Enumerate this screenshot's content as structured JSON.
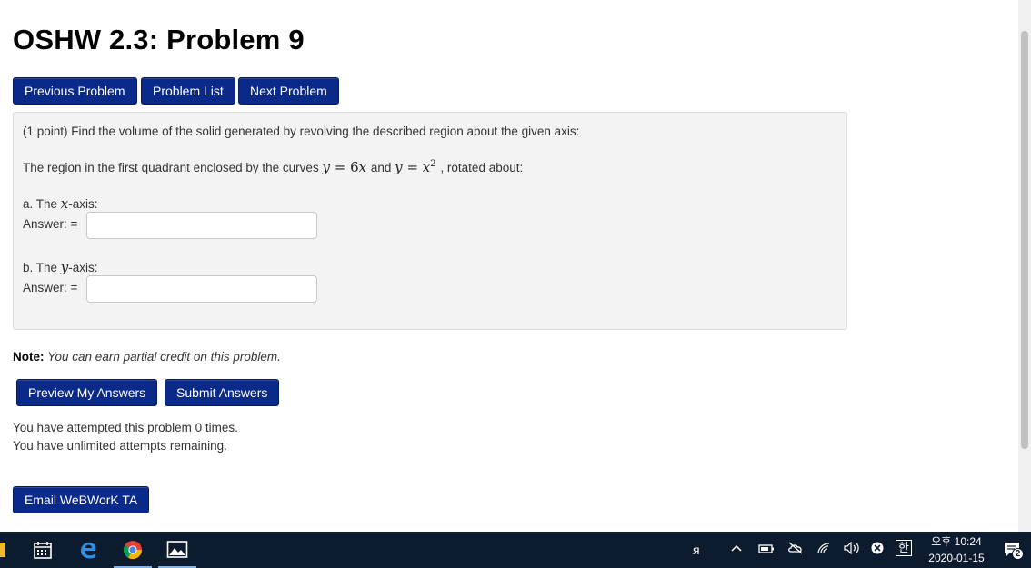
{
  "page": {
    "title": "OSHW 2.3: Problem 9"
  },
  "nav": {
    "previous": "Previous Problem",
    "list": "Problem List",
    "next": "Next Problem"
  },
  "problem": {
    "intro": "(1 point) Find the volume of the solid generated by revolving the described region about the given axis:",
    "region_prefix": "The region in the first quadrant enclosed by the curves",
    "curve1_lhs": "y",
    "curve1_eq": "=",
    "curve1_coef": "6",
    "curve1_var": "x",
    "and_word": "and",
    "curve2_lhs": "y",
    "curve2_eq": "=",
    "curve2_var": "x",
    "curve2_exp": "2",
    "region_suffix": ", rotated about:",
    "part_a_prefix": "a. The",
    "part_a_var": "x",
    "part_a_suffix": "-axis:",
    "part_b_prefix": "b. The",
    "part_b_var": "y",
    "part_b_suffix": "-axis:",
    "answer_label": "Answer: =",
    "answer_a_value": "",
    "answer_b_value": ""
  },
  "note": {
    "label": "Note:",
    "text": "You can earn partial credit on this problem."
  },
  "actions": {
    "preview": "Preview My Answers",
    "submit": "Submit Answers",
    "email": "Email WeBWorK TA"
  },
  "status": {
    "attempted": "You have attempted this problem 0 times.",
    "remaining": "You have unlimited attempts remaining."
  },
  "taskbar": {
    "icons": [
      "calendar-icon",
      "edge-icon",
      "chrome-icon",
      "photos-icon"
    ],
    "tray_people": "ᴙ",
    "ime": "한",
    "time": "오후 10:24",
    "date": "2020-01-15",
    "notifications": "2"
  },
  "colors": {
    "button_bg": "#0a2a8a",
    "problem_bg": "#f3f3f3",
    "taskbar_bg": "#0d1b2e"
  }
}
